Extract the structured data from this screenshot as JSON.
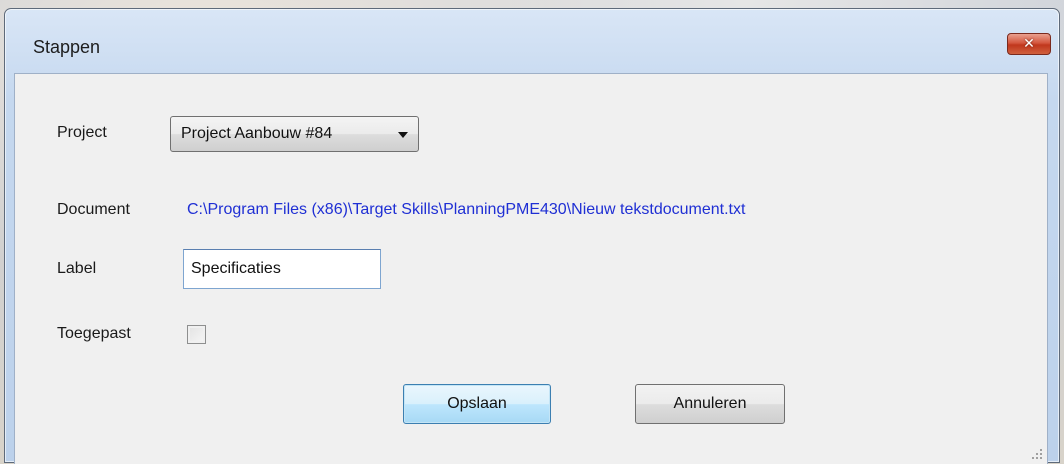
{
  "window": {
    "title": "Stappen",
    "close_icon": "close-icon"
  },
  "form": {
    "project_label": "Project",
    "project_selected": "Project Aanbouw #84",
    "document_label": "Document",
    "document_path": "C:\\Program Files (x86)\\Target Skills\\PlanningPME430\\Nieuw tekstdocument.txt",
    "label_label": "Label",
    "label_value": "Specificaties",
    "applied_label": "Toegepast",
    "applied_checked": false
  },
  "buttons": {
    "save_label": "Opslaan",
    "cancel_label": "Annuleren"
  },
  "colors": {
    "link": "#1f2fd4",
    "close_button": "#c0371d",
    "primary_button_border": "#3c7fb1"
  }
}
